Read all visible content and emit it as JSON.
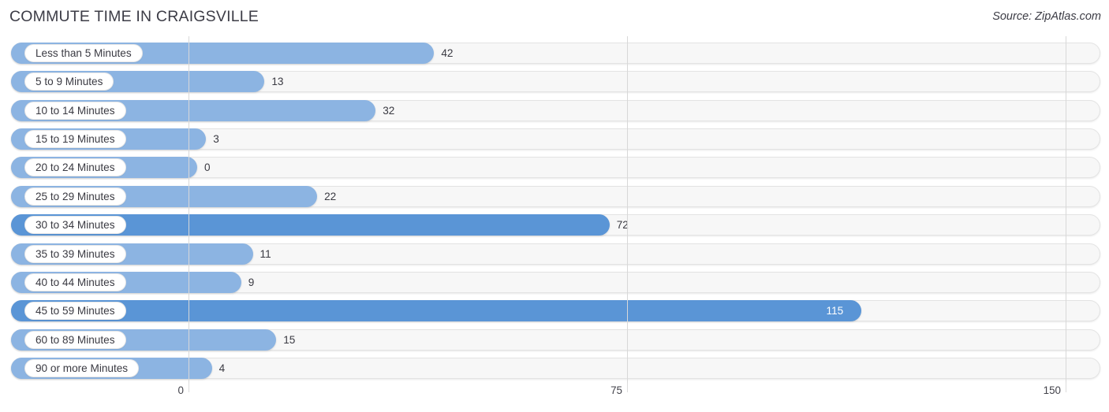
{
  "header": {
    "title": "COMMUTE TIME IN CRAIGSVILLE",
    "source": "Source: ZipAtlas.com"
  },
  "colors": {
    "bar_light": "#8cb4e2",
    "bar_dark": "#5a95d6",
    "track": "#f7f7f7",
    "track_border": "#e3e3e3",
    "gridline": "#d8d8d8",
    "text": "#3a3a42",
    "value_inside": "#ffffff"
  },
  "chart_data": {
    "type": "bar",
    "orientation": "horizontal",
    "title": "COMMUTE TIME IN CRAIGSVILLE",
    "xlabel": "",
    "ylabel": "",
    "xlim": [
      0,
      150
    ],
    "xticks": [
      0,
      75,
      150
    ],
    "xtick_labels": [
      "0",
      "75",
      "150"
    ],
    "grid": true,
    "legend": false,
    "categories": [
      "Less than 5 Minutes",
      "5 to 9 Minutes",
      "10 to 14 Minutes",
      "15 to 19 Minutes",
      "20 to 24 Minutes",
      "25 to 29 Minutes",
      "30 to 34 Minutes",
      "35 to 39 Minutes",
      "40 to 44 Minutes",
      "45 to 59 Minutes",
      "60 to 89 Minutes",
      "90 or more Minutes"
    ],
    "values": [
      42,
      13,
      32,
      3,
      0,
      22,
      72,
      11,
      9,
      115,
      15,
      4
    ],
    "value_labels": [
      "42",
      "13",
      "32",
      "3",
      "0",
      "22",
      "72",
      "11",
      "9",
      "115",
      "15",
      "4"
    ]
  },
  "rows": [
    {
      "label": "Less than 5 Minutes",
      "value": 42,
      "value_label": "42",
      "inside": false,
      "emphasis": false
    },
    {
      "label": "5 to 9 Minutes",
      "value": 13,
      "value_label": "13",
      "inside": false,
      "emphasis": false
    },
    {
      "label": "10 to 14 Minutes",
      "value": 32,
      "value_label": "32",
      "inside": false,
      "emphasis": false
    },
    {
      "label": "15 to 19 Minutes",
      "value": 3,
      "value_label": "3",
      "inside": false,
      "emphasis": false
    },
    {
      "label": "20 to 24 Minutes",
      "value": 0,
      "value_label": "0",
      "inside": false,
      "emphasis": false
    },
    {
      "label": "25 to 29 Minutes",
      "value": 22,
      "value_label": "22",
      "inside": false,
      "emphasis": false
    },
    {
      "label": "30 to 34 Minutes",
      "value": 72,
      "value_label": "72",
      "inside": false,
      "emphasis": true
    },
    {
      "label": "35 to 39 Minutes",
      "value": 11,
      "value_label": "11",
      "inside": false,
      "emphasis": false
    },
    {
      "label": "40 to 44 Minutes",
      "value": 9,
      "value_label": "9",
      "inside": false,
      "emphasis": false
    },
    {
      "label": "45 to 59 Minutes",
      "value": 115,
      "value_label": "115",
      "inside": true,
      "emphasis": true
    },
    {
      "label": "60 to 89 Minutes",
      "value": 15,
      "value_label": "15",
      "inside": false,
      "emphasis": false
    },
    {
      "label": "90 or more Minutes",
      "value": 4,
      "value_label": "4",
      "inside": false,
      "emphasis": false
    }
  ],
  "axis": {
    "ticks": [
      {
        "label": "0",
        "value": 0
      },
      {
        "label": "75",
        "value": 75
      },
      {
        "label": "150",
        "value": 150
      }
    ]
  }
}
